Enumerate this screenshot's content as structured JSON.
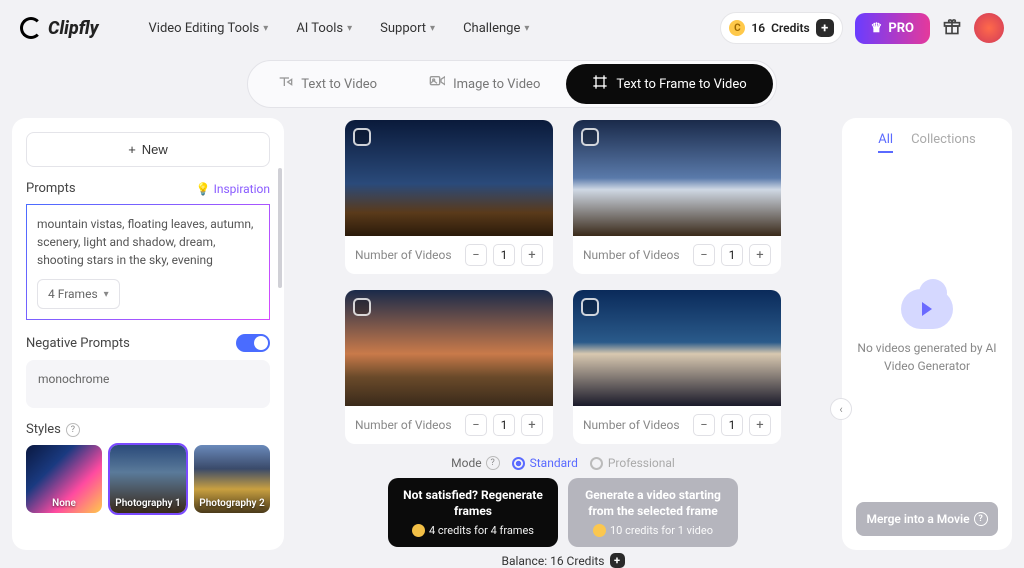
{
  "brand": "Clipfly",
  "nav": {
    "items": [
      {
        "label": "Video Editing Tools"
      },
      {
        "label": "AI Tools"
      },
      {
        "label": "Support"
      },
      {
        "label": "Challenge"
      }
    ]
  },
  "header": {
    "credits_value": "16",
    "credits_label": "Credits",
    "pro_label": "PRO"
  },
  "mode_tabs": [
    {
      "label": "Text to Video",
      "active": false
    },
    {
      "label": "Image to Video",
      "active": false
    },
    {
      "label": "Text to Frame to Video",
      "active": true
    }
  ],
  "left": {
    "new_label": "New",
    "prompts_label": "Prompts",
    "inspiration_label": "Inspiration",
    "prompt_text": "mountain vistas, floating leaves, autumn, scenery,  light and shadow, dream, shooting stars in the sky, evening",
    "frames_select_label": "4 Frames",
    "negative_label": "Negative Prompts",
    "negative_text": "monochrome",
    "styles_label": "Styles",
    "styles": [
      {
        "label": "None"
      },
      {
        "label": "Photography 1"
      },
      {
        "label": "Photography 2"
      }
    ]
  },
  "frames": {
    "num_label": "Number of Videos",
    "items": [
      {
        "value": "1"
      },
      {
        "value": "1"
      },
      {
        "value": "1"
      },
      {
        "value": "1"
      }
    ]
  },
  "gen_mode": {
    "label": "Mode",
    "standard": "Standard",
    "professional": "Professional"
  },
  "actions": {
    "regen_title": "Not satisfied? Regenerate frames",
    "regen_sub": "4 credits for 4 frames",
    "gen_title": "Generate a video starting from the selected frame",
    "gen_sub": "10 credits for 1 video"
  },
  "balance": {
    "label": "Balance: 16 Credits"
  },
  "right": {
    "tab_all": "All",
    "tab_collections": "Collections",
    "empty_text": "No videos generated by AI Video Generator",
    "merge_label": "Merge into a Movie"
  }
}
